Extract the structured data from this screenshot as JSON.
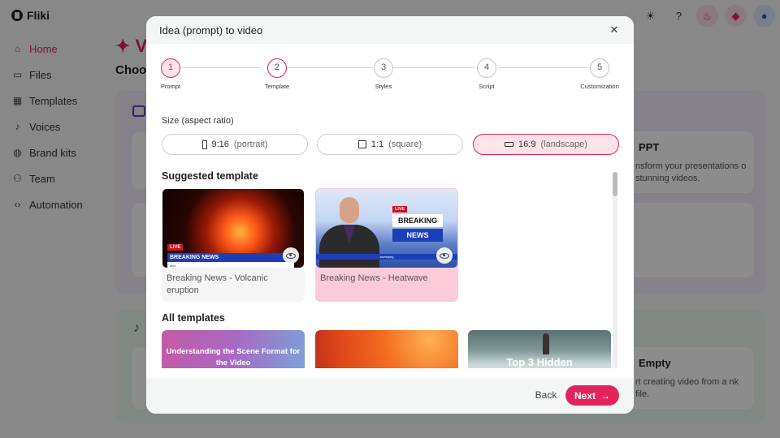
{
  "app": {
    "logo": "Fliki",
    "sidebar": [
      {
        "label": "Home",
        "icon": "home-icon",
        "glyph": "⌂"
      },
      {
        "label": "Files",
        "icon": "folder-icon",
        "glyph": "▭"
      },
      {
        "label": "Templates",
        "icon": "templates-icon",
        "glyph": "▦"
      },
      {
        "label": "Voices",
        "icon": "mic-icon",
        "glyph": "♪"
      },
      {
        "label": "Brand kits",
        "icon": "palette-icon",
        "glyph": "◍"
      },
      {
        "label": "Team",
        "icon": "team-icon",
        "glyph": "⚇"
      },
      {
        "label": "Automation",
        "icon": "code-icon",
        "glyph": "‹›"
      }
    ],
    "main_title": "✦ V",
    "main_subtitle": "Choos",
    "bg_cards": {
      "ppt_title": "PPT",
      "ppt_desc": "nsform your presentations o stunning videos.",
      "empty_title": "Empty",
      "empty_desc": "rt creating video from a nk file."
    }
  },
  "modal": {
    "title": "Idea (prompt) to video",
    "close_icon": "close-icon",
    "steps": [
      {
        "number": "1",
        "label": "Prompt",
        "state": "active"
      },
      {
        "number": "2",
        "label": "Template",
        "state": "done"
      },
      {
        "number": "3",
        "label": "Styles",
        "state": "todo"
      },
      {
        "number": "4",
        "label": "Script",
        "state": "todo"
      },
      {
        "number": "5",
        "label": "Customization",
        "state": "todo"
      }
    ],
    "size_label": "Size (aspect ratio)",
    "ratios": [
      {
        "value": "9:16",
        "desc": "(portrait)",
        "selected": false
      },
      {
        "value": "1:1",
        "desc": "(square)",
        "selected": false
      },
      {
        "value": "16:9",
        "desc": "(landscape)",
        "selected": true
      }
    ],
    "suggested_title": "Suggested template",
    "suggested": [
      {
        "name": "Breaking News - Volcanic eruption",
        "live": "LIVE",
        "headline": "BREAKING NEWS",
        "ticker": "and",
        "selected": false
      },
      {
        "name": "Breaking News - Heatwave",
        "live": "LIVE",
        "line1": "BREAKING",
        "line2": "NEWS",
        "ticker": "sweeping",
        "selected": true
      }
    ],
    "all_title": "All templates",
    "all_templates": [
      {
        "text": "Understanding the Scene Format for the Video"
      },
      {
        "text": ""
      },
      {
        "text": "Top 3 Hidden"
      }
    ],
    "back_label": "Back",
    "next_label": "Next",
    "next_icon": "arrow-right-icon"
  },
  "colors": {
    "accent": "#e2245c",
    "accent_soft": "#fde4ea",
    "news_blue": "#1c3fb9"
  }
}
